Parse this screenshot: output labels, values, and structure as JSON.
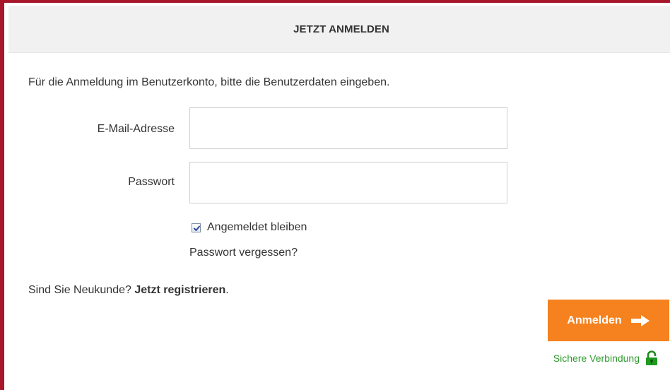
{
  "header": {
    "title": "JETZT ANMELDEN"
  },
  "intro_text": "Für die Anmeldung im Benutzerkonto, bitte die Benutzerdaten eingeben.",
  "form": {
    "email_label": "E-Mail-Adresse",
    "email_value": "",
    "password_label": "Passwort",
    "password_value": "",
    "remember_label": "Angemeldet bleiben",
    "remember_checked": true,
    "forgot_link": "Passwort vergessen?"
  },
  "register": {
    "prefix": "Sind Sie Neukunde? ",
    "link": "Jetzt registrieren",
    "suffix": "."
  },
  "login_button": {
    "label": "Anmelden",
    "icon": "arrow-right-icon"
  },
  "secure": {
    "label": "Sichere Verbindung",
    "icon": "lock-icon"
  },
  "colors": {
    "frame_border": "#a7162b",
    "button": "#f5821f",
    "secure_text": "#2f9a2f"
  }
}
